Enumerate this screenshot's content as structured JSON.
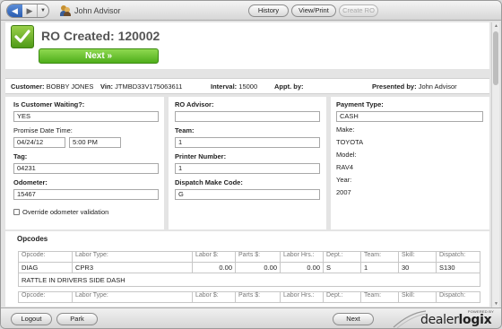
{
  "toolbar": {
    "user_name": "John Advisor",
    "history_label": "History",
    "view_print_label": "View/Print",
    "create_ro_label": "Create RO",
    "back_glyph": "◀",
    "forward_glyph": "▶",
    "dropdown_glyph": "▼"
  },
  "header": {
    "title": "RO Created: 120002",
    "next_label": "Next »"
  },
  "customer_bar": {
    "customer_label": "Customer:",
    "customer_value": "BOBBY JONES",
    "vin_label": "Vin:",
    "vin_value": "JTMBD33V175063611",
    "interval_label": "Interval:",
    "interval_value": "15000",
    "appt_label": "Appt. by:",
    "presented_label": "Presented by:",
    "presented_value": "John Advisor"
  },
  "left_panel": {
    "waiting_label": "Is Customer Waiting?:",
    "waiting_value": "YES",
    "promise_label": "Promise Date Time:",
    "promise_date": "04/24/12",
    "promise_time": "5:00 PM",
    "tag_label": "Tag:",
    "tag_value": "04231",
    "odometer_label": "Odometer:",
    "odometer_value": "15467",
    "override_label": "Override odometer validation"
  },
  "middle_panel": {
    "advisor_label": "RO Advisor:",
    "advisor_value": "",
    "team_label": "Team:",
    "team_value": "1",
    "printer_label": "Printer Number:",
    "printer_value": "1",
    "dispatch_label": "Dispatch Make Code:",
    "dispatch_value": "G"
  },
  "right_panel": {
    "payment_label": "Payment Type:",
    "payment_value": "CASH",
    "make_label": "Make:",
    "make_value": "TOYOTA",
    "model_label": "Model:",
    "model_value": "RAV4",
    "year_label": "Year:",
    "year_value": "2007"
  },
  "opcodes": {
    "title": "Opcodes",
    "headers": {
      "opcode": "Opcode:",
      "labor_type": "Labor Type:",
      "labor": "Labor $:",
      "parts": "Parts $:",
      "labor_hrs": "Labor Hrs.:",
      "dept": "Dept.:",
      "team": "Team:",
      "skill": "Skill:",
      "dispatch": "Dispatch:"
    },
    "row1": {
      "opcode": "DIAG",
      "labor_type": "CPR3",
      "labor": "0.00",
      "parts": "0.00",
      "labor_hrs": "0.00",
      "dept": "S",
      "team": "1",
      "skill": "30",
      "dispatch": "S130",
      "description": "RATTLE IN DRIVERS SIDE DASH"
    }
  },
  "bottom": {
    "logout_label": "Logout",
    "park_label": "Park",
    "next_label": "Next",
    "powered_by": "POWERED BY",
    "brand_part1": "dealer",
    "brand_part2": "logix"
  }
}
